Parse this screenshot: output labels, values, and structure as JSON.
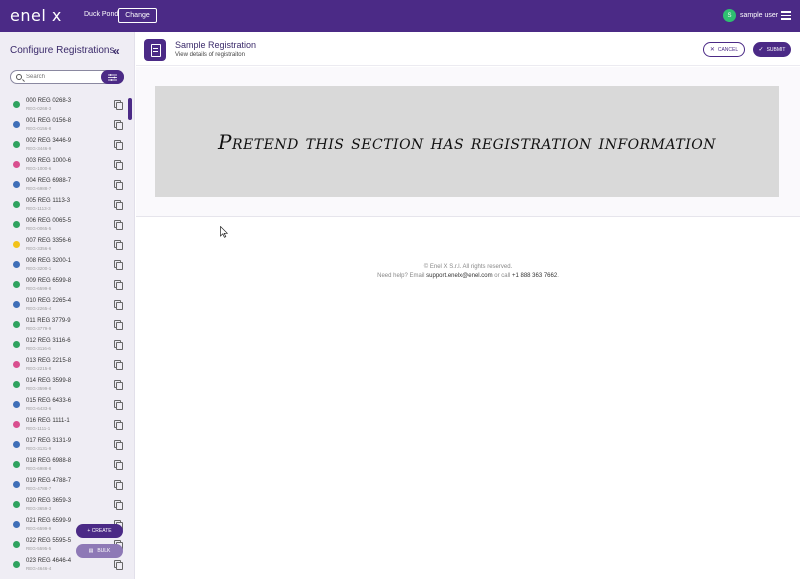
{
  "topbar": {
    "logo": "enel x",
    "site_name": "Duck Pond",
    "change_label": "Change",
    "user_initial": "S",
    "user_name": "sample user"
  },
  "sidebar": {
    "title": "Configure Registrations",
    "search_placeholder": "Search",
    "create_label": "+ CREATE",
    "bulk_label": "BULK",
    "items": [
      {
        "name": "000 REG 0268-3",
        "sub": "REG-0268-3",
        "color": "#2fa35f"
      },
      {
        "name": "001 REG 0156-8",
        "sub": "REG-0156-8",
        "color": "#3f6fb8"
      },
      {
        "name": "002 REG 3446-9",
        "sub": "REG-3446-9",
        "color": "#2fa35f"
      },
      {
        "name": "003 REG 1000-6",
        "sub": "REG-1000-6",
        "color": "#d94f8f"
      },
      {
        "name": "004 REG 6988-7",
        "sub": "REG-6988-7",
        "color": "#3f6fb8"
      },
      {
        "name": "005 REG 1113-3",
        "sub": "REG-1113-3",
        "color": "#2fa35f"
      },
      {
        "name": "006 REG 0065-5",
        "sub": "REG-0065-5",
        "color": "#2fa35f"
      },
      {
        "name": "007 REG 3356-6",
        "sub": "REG-3356-6",
        "color": "#f2c21a"
      },
      {
        "name": "008 REG 3200-1",
        "sub": "REG-3200-1",
        "color": "#3f6fb8"
      },
      {
        "name": "009 REG 6599-8",
        "sub": "REG-6599-8",
        "color": "#2fa35f"
      },
      {
        "name": "010 REG 2265-4",
        "sub": "REG-2265-4",
        "color": "#3f6fb8"
      },
      {
        "name": "011 REG 3779-9",
        "sub": "REG-3779-9",
        "color": "#2fa35f"
      },
      {
        "name": "012 REG 3116-6",
        "sub": "REG-3116-6",
        "color": "#2fa35f"
      },
      {
        "name": "013 REG 2215-8",
        "sub": "REG-2215-8",
        "color": "#d94f8f"
      },
      {
        "name": "014 REG 3599-8",
        "sub": "REG-3599-8",
        "color": "#2fa35f"
      },
      {
        "name": "015 REG 6433-6",
        "sub": "REG-6433-6",
        "color": "#3f6fb8"
      },
      {
        "name": "016 REG 1111-1",
        "sub": "REG-1111-1",
        "color": "#d94f8f"
      },
      {
        "name": "017 REG 3131-9",
        "sub": "REG-3131-9",
        "color": "#3f6fb8"
      },
      {
        "name": "018 REG 6988-8",
        "sub": "REG-6988-8",
        "color": "#2fa35f"
      },
      {
        "name": "019 REG 4788-7",
        "sub": "REG-4788-7",
        "color": "#3f6fb8"
      },
      {
        "name": "020 REG 3659-3",
        "sub": "REG-3659-3",
        "color": "#2fa35f"
      },
      {
        "name": "021 REG 6599-9",
        "sub": "REG-6599-9",
        "color": "#3f6fb8"
      },
      {
        "name": "022 REG 5595-5",
        "sub": "REG-5595-5",
        "color": "#2fa35f"
      },
      {
        "name": "023 REG 4646-4",
        "sub": "REG-4646-4",
        "color": "#2fa35f"
      }
    ]
  },
  "header": {
    "title": "Sample Registration",
    "subtitle": "View details of registraiton",
    "cancel_label": "CANCEL",
    "submit_label": "SUBMIT"
  },
  "content": {
    "placeholder": "Pretend this section has registration information"
  },
  "footer": {
    "copyright": "© Enel X S.r.l. All rights reserved.",
    "help_prefix": "Need help? Email",
    "email": "support.enelx@enel.com",
    "or_call": "or call",
    "phone": "+1 888 363 7662",
    "period": "."
  },
  "icons": {
    "menu": "menu-icon",
    "collapse": "chevron-double-left-icon",
    "search": "search-icon",
    "filter": "filter-icon",
    "copy": "copy-icon",
    "document": "document-icon"
  },
  "colors": {
    "brand": "#4b2a86",
    "bulk": "#8e79b6",
    "avatar": "#2fbf71"
  }
}
